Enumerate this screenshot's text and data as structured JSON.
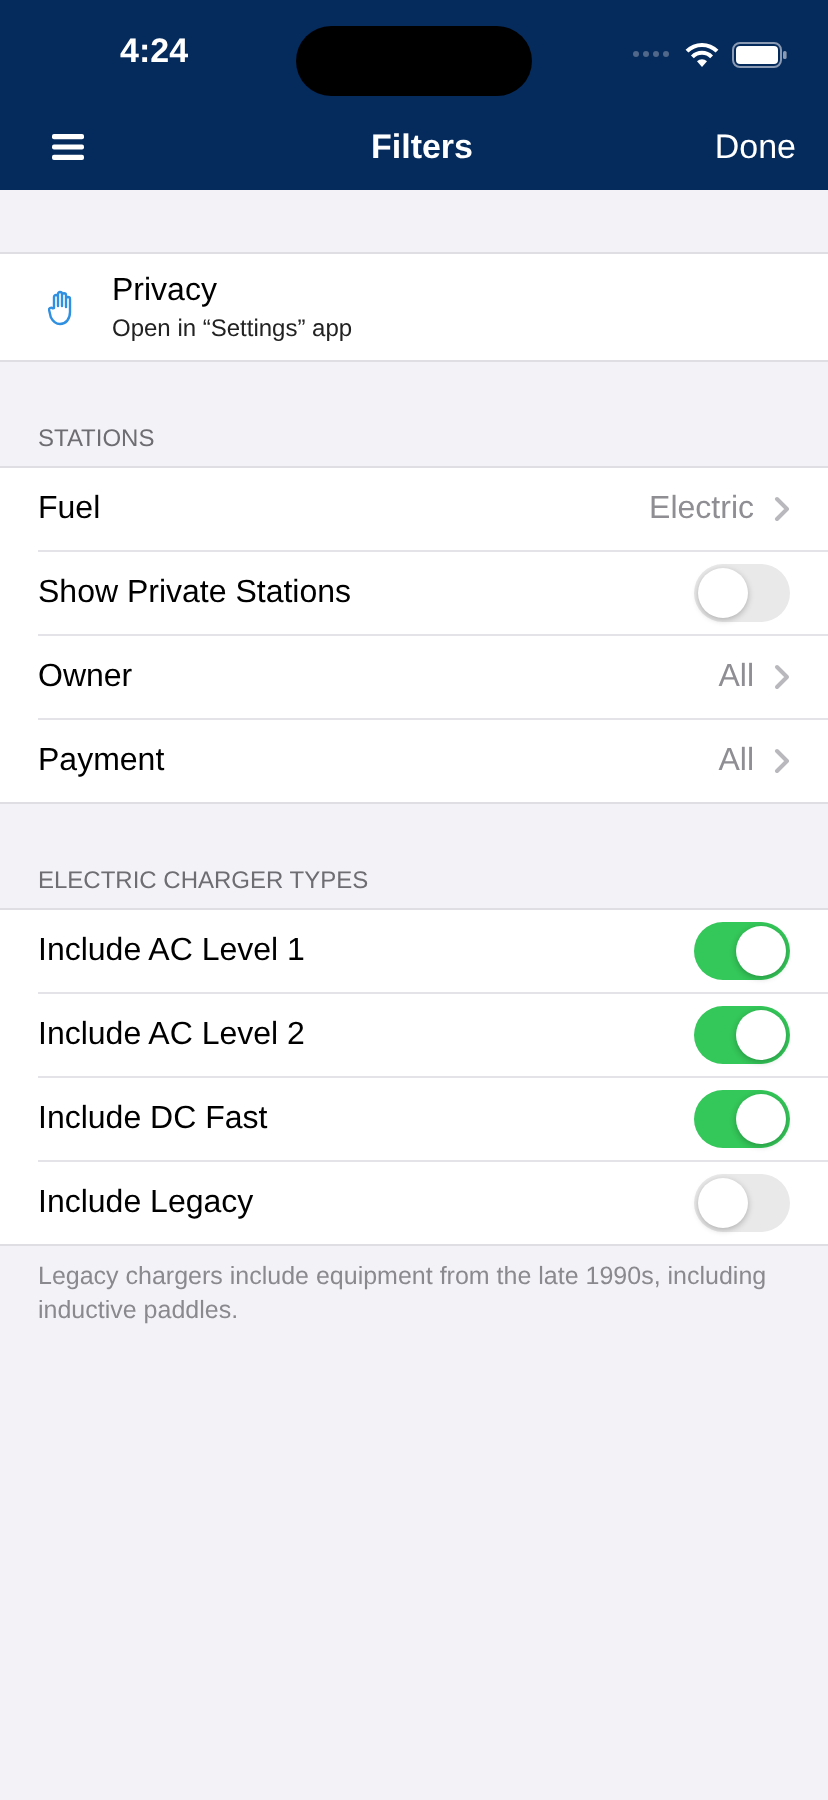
{
  "status_bar": {
    "time": "4:24"
  },
  "nav": {
    "title": "Filters",
    "done": "Done"
  },
  "privacy": {
    "title": "Privacy",
    "subtitle": "Open in “Settings” app"
  },
  "sections": [
    {
      "header": "STATIONS",
      "rows": [
        {
          "kind": "value",
          "label": "Fuel",
          "value": "Electric"
        },
        {
          "kind": "toggle",
          "label": "Show Private Stations",
          "on": false
        },
        {
          "kind": "value",
          "label": "Owner",
          "value": "All"
        },
        {
          "kind": "value",
          "label": "Payment",
          "value": "All"
        }
      ]
    },
    {
      "header": "ELECTRIC CHARGER TYPES",
      "rows": [
        {
          "kind": "toggle",
          "label": "Include AC Level 1",
          "on": true
        },
        {
          "kind": "toggle",
          "label": "Include AC Level 2",
          "on": true
        },
        {
          "kind": "toggle",
          "label": "Include DC Fast",
          "on": true
        },
        {
          "kind": "toggle",
          "label": "Include Legacy",
          "on": false
        }
      ],
      "footer": "Legacy chargers include equipment from the late 1990s, including inductive paddles."
    }
  ]
}
